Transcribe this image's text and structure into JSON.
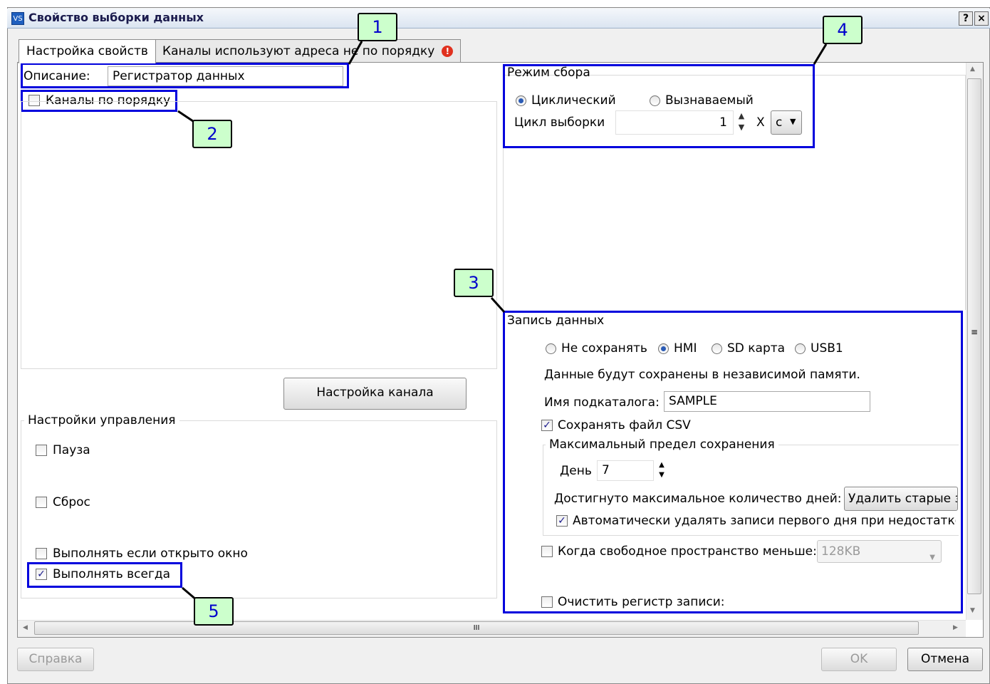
{
  "window": {
    "title": "Свойство выборки данных",
    "app_icon_text": "VS",
    "help_button": "?",
    "close_button": "×"
  },
  "tabs": [
    {
      "label": "Настройка свойств",
      "active": true
    },
    {
      "label": "Каналы используют адреса не по порядку",
      "warning_icon": "error-icon"
    }
  ],
  "left": {
    "description_label": "Описание:",
    "description_value": "Регистратор данных",
    "channels_in_order_label": "Каналы по порядку",
    "channels_in_order_checked": false,
    "channel_settings_button": "Настройка канала",
    "control": {
      "title": "Настройки управления",
      "pause": {
        "label": "Пауза",
        "checked": false
      },
      "reset": {
        "label": "Сброс",
        "checked": false
      },
      "run_if_open": {
        "label": "Выполнять если открыто окно",
        "checked": false
      },
      "run_always": {
        "label": "Выполнять всегда",
        "checked": true
      }
    }
  },
  "collection": {
    "title": "Режим сбора",
    "cyclic_label": "Циклический",
    "triggered_label": "Вызнаваемый",
    "selected": "cyclic",
    "cycle_label": "Цикл выборки",
    "cycle_value": "1",
    "multiplier": "X",
    "unit": "с"
  },
  "record": {
    "title": "Запись данных",
    "storage_options": [
      "Не сохранять",
      "HMI",
      "SD карта",
      "USB1"
    ],
    "storage_selected": "HMI",
    "info_text": "Данные будут сохранены в независимой памяти.",
    "subdir_label": "Имя подкаталога:",
    "subdir_value": "SAMPLE",
    "save_csv_label": "Сохранять файл CSV",
    "save_csv_checked": true,
    "max_limit_title": "Максимальный предел сохранения",
    "day_label": "День",
    "day_value": "7",
    "max_days_label": "Достигнуто максимальное количество дней:",
    "delete_old_button": "Удалить старые з",
    "auto_delete_label": "Автоматически удалять записи первого дня при недостатке",
    "auto_delete_checked": true,
    "free_space_label": "Когда свободное пространство меньше:",
    "free_space_checked": false,
    "free_space_value": "128KB",
    "clear_register_label": "Очистить регистр записи:",
    "clear_register_checked": false
  },
  "scroll": {
    "h_grip": "III",
    "v_grip": "≡"
  },
  "footer": {
    "help": "Справка",
    "ok": "OK",
    "cancel": "Отмена"
  },
  "callouts": [
    "1",
    "2",
    "3",
    "4",
    "5"
  ],
  "colors": {
    "callout_border": "#0000dd",
    "callout_fill": "#ccffcc",
    "callout_text": "#0000cc",
    "check_mark": "#1a1a8c"
  }
}
